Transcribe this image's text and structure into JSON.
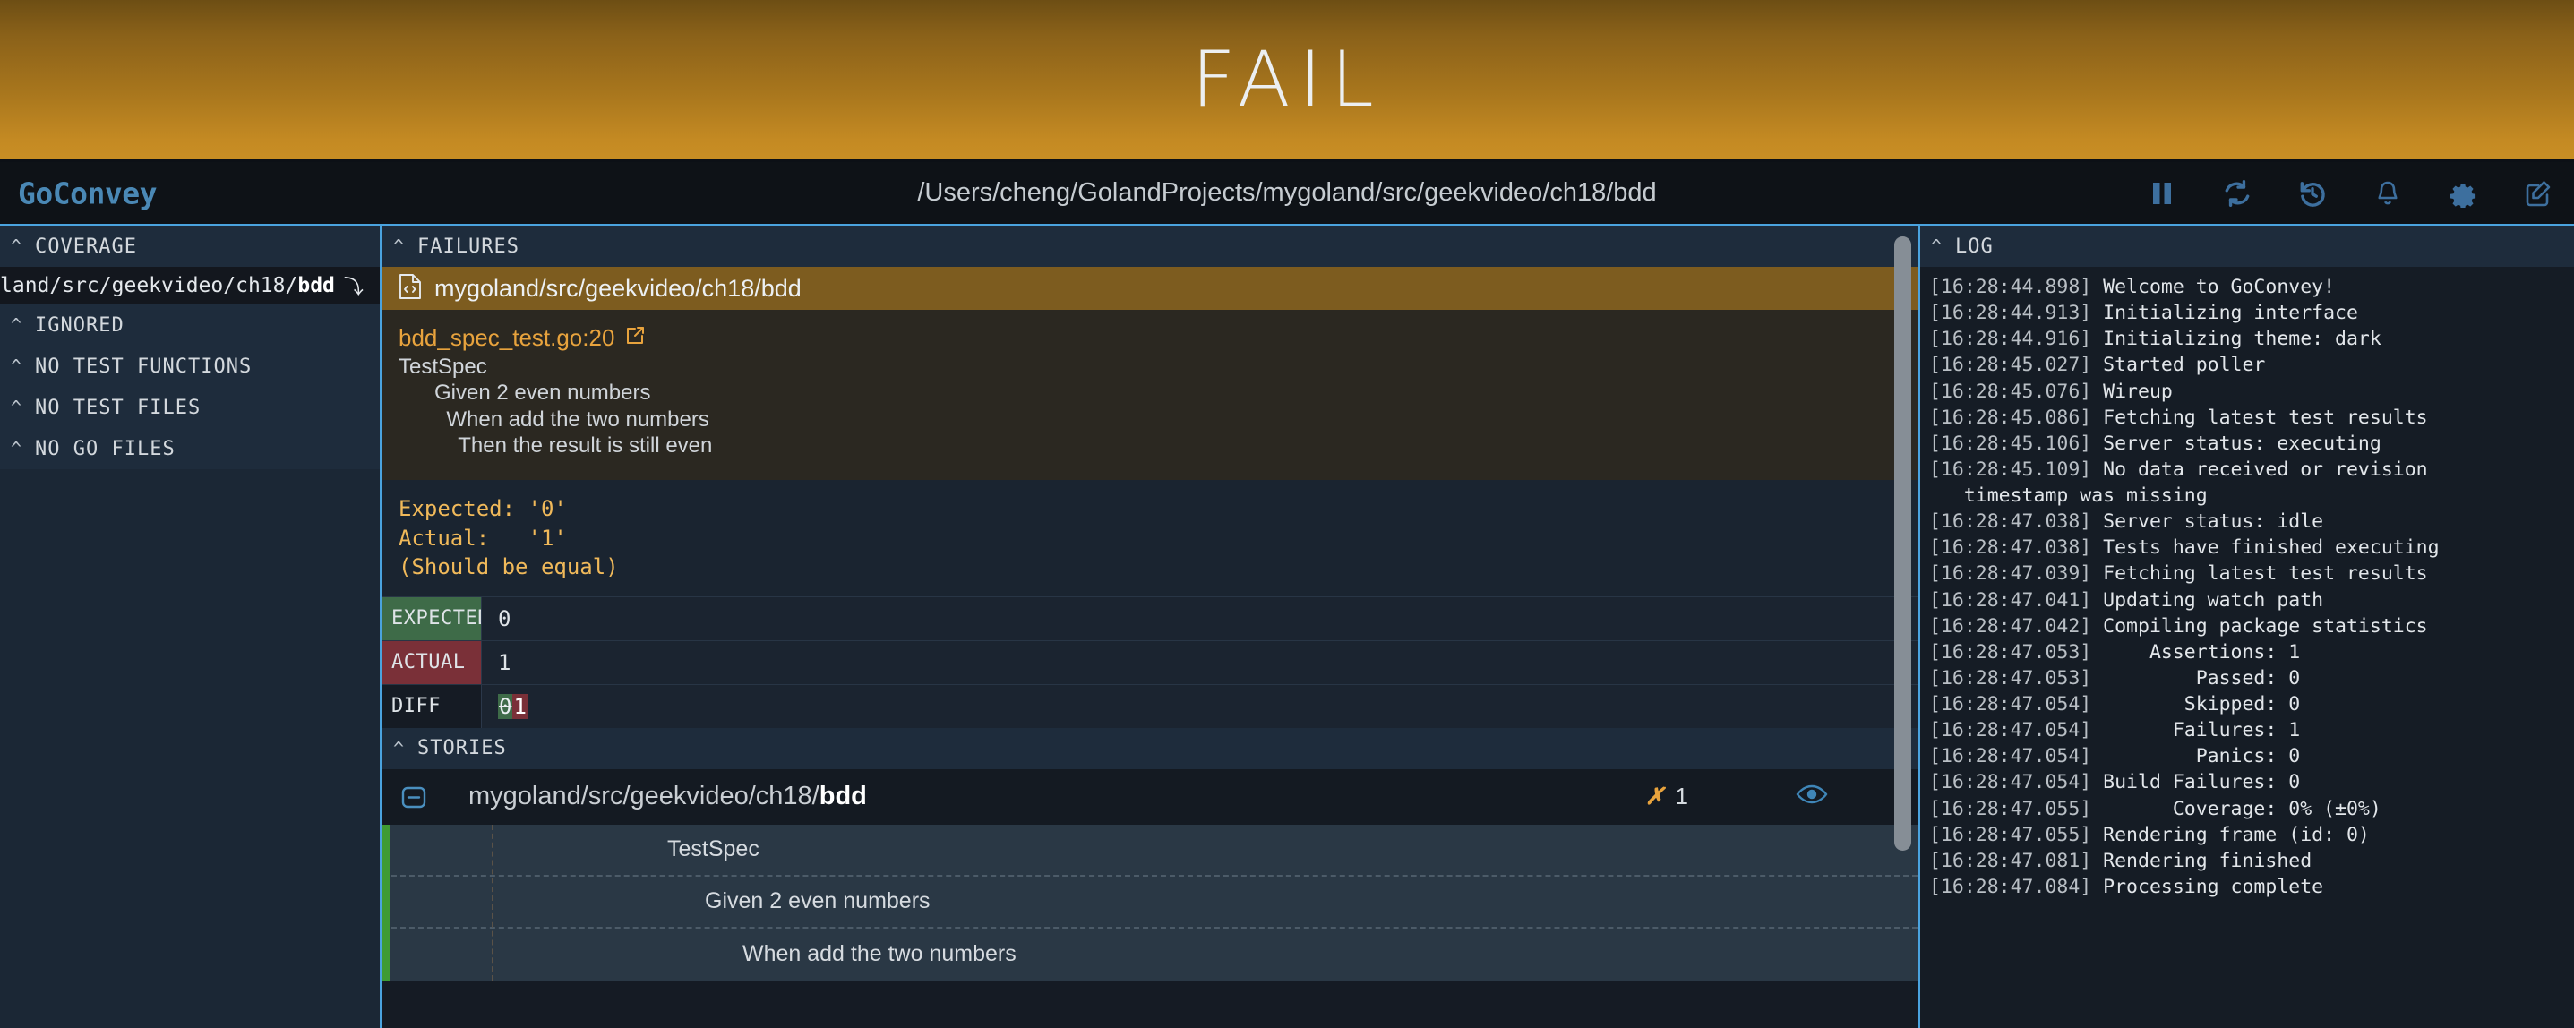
{
  "banner": {
    "status": "FAIL"
  },
  "header": {
    "brand": "GoConvey",
    "path": "/Users/cheng/GolandProjects/mygoland/src/geekvideo/ch18/bdd",
    "toolbar": [
      {
        "name": "pause-icon",
        "label": "Pause"
      },
      {
        "name": "refresh-icon",
        "label": "Refresh"
      },
      {
        "name": "history-icon",
        "label": "History"
      },
      {
        "name": "bell-icon",
        "label": "Notifications"
      },
      {
        "name": "gear-icon",
        "label": "Settings"
      },
      {
        "name": "compose-icon",
        "label": "Compose"
      }
    ]
  },
  "sidebar": {
    "sections": [
      {
        "label": "COVERAGE"
      },
      {
        "label": "IGNORED"
      },
      {
        "label": "NO TEST FUNCTIONS"
      },
      {
        "label": "NO TEST FILES"
      },
      {
        "label": "NO GO FILES"
      }
    ],
    "coverage_item": {
      "path_prefix": "land/src/geekvideo/ch18/",
      "path_bold": "bdd",
      "arrow": "⤵"
    }
  },
  "failures": {
    "section_label": "FAILURES",
    "package": "mygoland/src/geekvideo/ch18/bdd",
    "file": "bdd_spec_test.go:20",
    "story_lines": [
      "TestSpec",
      "      Given 2 even numbers",
      "        When add the two numbers",
      "          Then the result is still even"
    ],
    "assertion": "Expected: '0'\nActual:   '1'\n(Should be equal)",
    "comparison": [
      {
        "key": "EXPECTED",
        "value": "0"
      },
      {
        "key": "ACTUAL",
        "value": "1"
      }
    ],
    "diff": {
      "key": "DIFF",
      "removed": "0",
      "added": "1"
    }
  },
  "stories": {
    "section_label": "STORIES",
    "package_prefix": "mygoland/src/geekvideo/ch18/",
    "package_bold": "bdd",
    "failure_mark": "✗",
    "failure_count": "1",
    "rows": [
      {
        "label": "TestSpec",
        "indent": 318
      },
      {
        "label": "Given 2 even numbers",
        "indent": 360
      },
      {
        "label": "When add the two numbers",
        "indent": 402
      }
    ]
  },
  "log": {
    "section_label": "LOG",
    "lines": [
      {
        "ts": "[16:28:44.898]",
        "msg": " Welcome to GoConvey!"
      },
      {
        "ts": "[16:28:44.913]",
        "msg": " Initializing interface"
      },
      {
        "ts": "[16:28:44.916]",
        "msg": " Initializing theme: dark"
      },
      {
        "ts": "[16:28:45.027]",
        "msg": " Started poller"
      },
      {
        "ts": "[16:28:45.076]",
        "msg": " Wireup"
      },
      {
        "ts": "[16:28:45.086]",
        "msg": " Fetching latest test results"
      },
      {
        "ts": "[16:28:45.106]",
        "msg": " Server status: executing"
      },
      {
        "ts": "[16:28:45.109]",
        "msg": " No data received or revision"
      },
      {
        "ts": "",
        "msg": "   timestamp was missing"
      },
      {
        "ts": "[16:28:47.038]",
        "msg": " Server status: idle"
      },
      {
        "ts": "[16:28:47.038]",
        "msg": " Tests have finished executing"
      },
      {
        "ts": "[16:28:47.039]",
        "msg": " Fetching latest test results"
      },
      {
        "ts": "[16:28:47.041]",
        "msg": " Updating watch path"
      },
      {
        "ts": "[16:28:47.042]",
        "msg": " Compiling package statistics"
      },
      {
        "ts": "[16:28:47.053]",
        "msg": "     Assertions: 1"
      },
      {
        "ts": "[16:28:47.053]",
        "msg": "         Passed: 0"
      },
      {
        "ts": "[16:28:47.054]",
        "msg": "        Skipped: 0"
      },
      {
        "ts": "[16:28:47.054]",
        "msg": "       Failures: 1"
      },
      {
        "ts": "[16:28:47.054]",
        "msg": "         Panics: 0"
      },
      {
        "ts": "[16:28:47.054]",
        "msg": " Build Failures: 0"
      },
      {
        "ts": "[16:28:47.055]",
        "msg": "       Coverage: 0% (±0%)"
      },
      {
        "ts": "[16:28:47.055]",
        "msg": " Rendering frame (id: 0)"
      },
      {
        "ts": "[16:28:47.081]",
        "msg": " Rendering finished"
      },
      {
        "ts": "[16:28:47.084]",
        "msg": " Processing complete"
      }
    ]
  },
  "colors": {
    "accent_blue": "#4aa3df",
    "fail_orange": "#c98e24",
    "pass_green": "#3f9b33",
    "expected_green": "#3e6b48",
    "actual_red": "#7a3038"
  }
}
